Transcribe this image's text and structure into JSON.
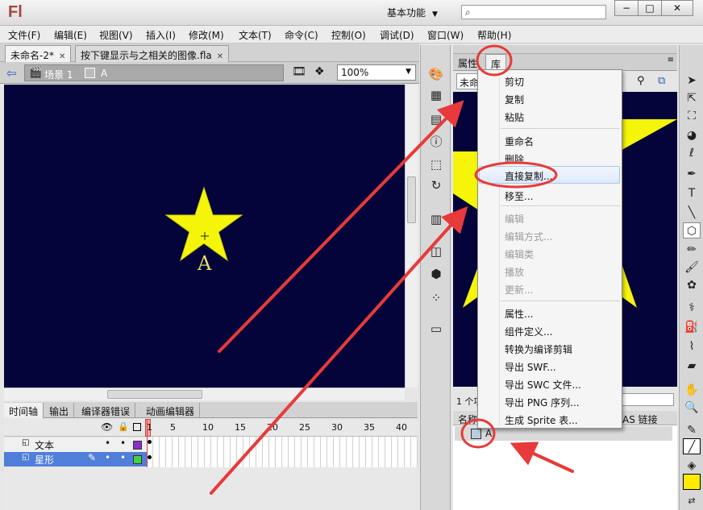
{
  "app": {
    "logo": "Fl",
    "workspace": "基本功能",
    "window_controls": [
      "−",
      "□",
      "✕"
    ]
  },
  "menubar": [
    "文件(F)",
    "编辑(E)",
    "视图(V)",
    "插入(I)",
    "修改(M)",
    "文本(T)",
    "命令(C)",
    "控制(O)",
    "调试(D)",
    "窗口(W)",
    "帮助(H)"
  ],
  "doc_tabs": [
    {
      "label": "未命名-2*",
      "close": "✕",
      "active": true
    },
    {
      "label": "按下键显示与之相关的图像.fla",
      "close": "✕",
      "active": false
    }
  ],
  "edit_bar": {
    "scene": "场景 1",
    "symbol": "A",
    "zoom": "100%"
  },
  "stage": {
    "background": "#04043a",
    "star_color": "#f5f50a",
    "label": "A"
  },
  "timeline": {
    "tabs": [
      "时间轴",
      "输出",
      "编译器错误",
      "动画编辑器"
    ],
    "frame_numbers": [
      "1",
      "5",
      "10",
      "15",
      "20",
      "25",
      "30",
      "35",
      "40"
    ],
    "layers": [
      {
        "name": "文本",
        "color": "#8d2fc8",
        "selected": false
      },
      {
        "name": "星形",
        "color": "#44d044",
        "selected": true
      }
    ]
  },
  "right_panel": {
    "tabs": [
      "属性",
      "库"
    ],
    "doc_select": "未命",
    "item_count": "1 个项",
    "columns": {
      "name": "名称",
      "linkage": "AS 链接"
    },
    "items": [
      {
        "name": "A"
      }
    ]
  },
  "context_menu": {
    "groups": [
      [
        {
          "label": "剪切",
          "enabled": true
        },
        {
          "label": "复制",
          "enabled": true
        },
        {
          "label": "粘贴",
          "enabled": true
        }
      ],
      [
        {
          "label": "重命名",
          "enabled": true
        },
        {
          "label": "删除",
          "enabled": true
        },
        {
          "label": "直接复制...",
          "enabled": true,
          "highlighted": true
        },
        {
          "label": "移至...",
          "enabled": true
        }
      ],
      [
        {
          "label": "编辑",
          "enabled": false
        },
        {
          "label": "编辑方式...",
          "enabled": false
        },
        {
          "label": "编辑类",
          "enabled": false
        },
        {
          "label": "播放",
          "enabled": false
        },
        {
          "label": "更新...",
          "enabled": false
        }
      ],
      [
        {
          "label": "属性...",
          "enabled": true
        },
        {
          "label": "组件定义...",
          "enabled": true
        },
        {
          "label": "转换为编译剪辑",
          "enabled": true
        },
        {
          "label": "导出 SWF...",
          "enabled": true
        },
        {
          "label": "导出 SWC 文件...",
          "enabled": true
        },
        {
          "label": "导出 PNG 序列...",
          "enabled": true
        },
        {
          "label": "生成 Sprite 表...",
          "enabled": true
        }
      ]
    ]
  },
  "colors": {
    "annotation_red": "#e83a3a",
    "stage_bg": "#04043a",
    "fill_swatch": "#ffea00",
    "menu_highlight": "#dde9fa"
  }
}
